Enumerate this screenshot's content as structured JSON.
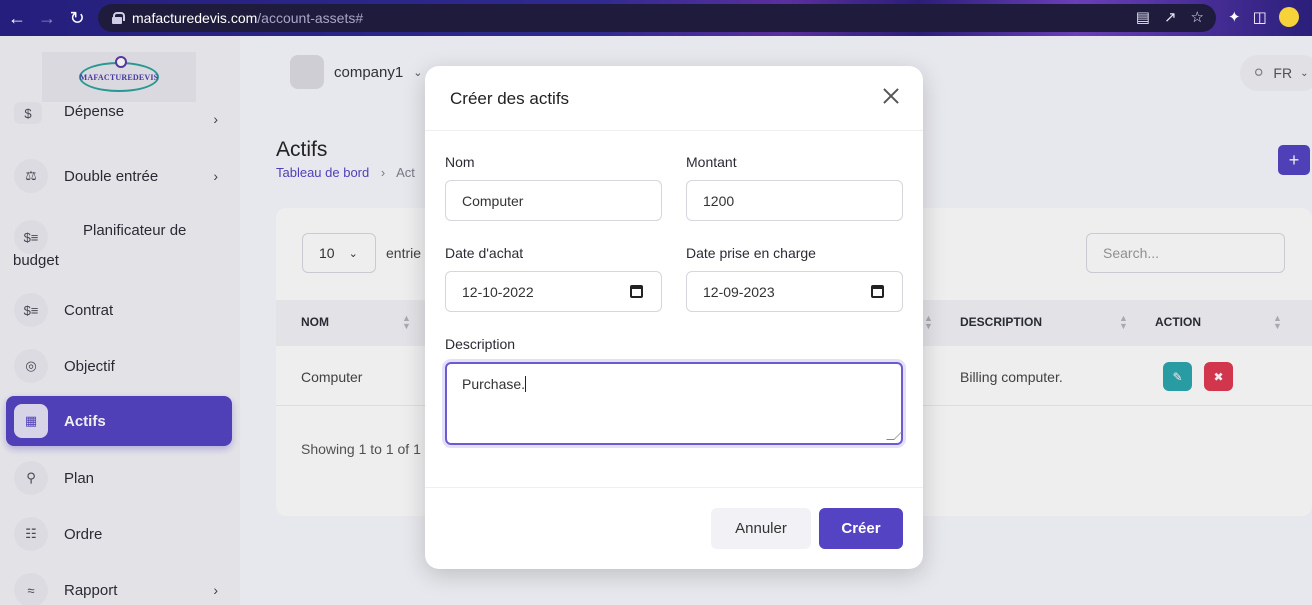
{
  "browser": {
    "url_host": "mafacturedevis.com",
    "url_path": "/account-assets#"
  },
  "sidebar": {
    "logo_text": "MAFACTUREDEVIS",
    "items": [
      {
        "label": "Dépense",
        "icon": "receipt-icon",
        "has_chevron": true
      },
      {
        "label": "Double entrée",
        "icon": "scale-icon",
        "has_chevron": true
      },
      {
        "label": "Planificateur de budget",
        "icon": "money-icon",
        "has_chevron": false
      },
      {
        "label": "Contrat",
        "icon": "money-icon",
        "has_chevron": false
      },
      {
        "label": "Objectif",
        "icon": "target-icon",
        "has_chevron": false
      },
      {
        "label": "Actifs",
        "icon": "calculator-icon",
        "has_chevron": false,
        "active": true
      },
      {
        "label": "Plan",
        "icon": "trophy-icon",
        "has_chevron": false
      },
      {
        "label": "Ordre",
        "icon": "cart-icon",
        "has_chevron": false
      },
      {
        "label": "Rapport",
        "icon": "chart-icon",
        "has_chevron": true
      }
    ]
  },
  "header": {
    "company": "company1",
    "language": "FR"
  },
  "page": {
    "title": "Actifs",
    "breadcrumb_home": "Tableau de bord",
    "breadcrumb_current": "Act"
  },
  "table": {
    "entries_value": "10",
    "entries_label": "entrie",
    "search_placeholder": "Search...",
    "columns": [
      "NOM",
      "DESCRIPTION",
      "ACTION"
    ],
    "rows": [
      {
        "nom": "Computer",
        "description": "Billing computer."
      }
    ],
    "showing": "Showing 1 to 1 of 1"
  },
  "modal": {
    "title": "Créer des actifs",
    "fields": {
      "nom_label": "Nom",
      "nom_value": "Computer",
      "montant_label": "Montant",
      "montant_value": "1200",
      "date_achat_label": "Date d'achat",
      "date_achat_value": "12-10-2022",
      "date_prise_label": "Date prise en charge",
      "date_prise_value": "12-09-2023",
      "description_label": "Description",
      "description_value": "Purchase."
    },
    "cancel_label": "Annuler",
    "create_label": "Créer"
  },
  "colors": {
    "accent": "#5443c3",
    "edit": "#2aa5ad",
    "delete": "#e0384f"
  }
}
